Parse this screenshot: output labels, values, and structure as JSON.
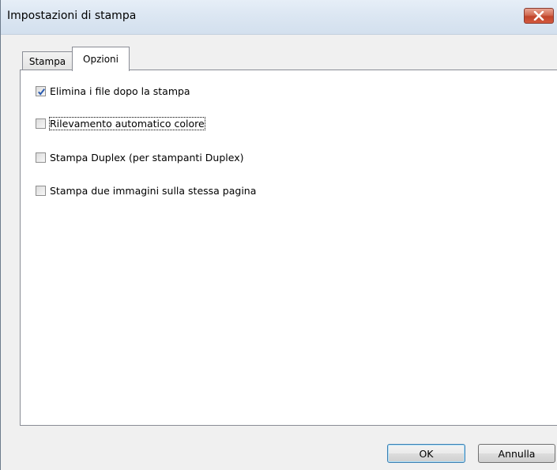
{
  "window": {
    "title": "Impostazioni di stampa"
  },
  "tabs": [
    {
      "label": "Stampa",
      "active": false
    },
    {
      "label": "Opzioni",
      "active": true
    }
  ],
  "options": [
    {
      "label": "Elimina i file dopo la stampa",
      "checked": true
    },
    {
      "label": "Rilevamento automatico colore",
      "checked": false,
      "focused": true
    },
    {
      "label": "Stampa Duplex (per stampanti Duplex)",
      "checked": false
    },
    {
      "label": "Stampa due immagini sulla stessa pagina",
      "checked": false
    }
  ],
  "buttons": {
    "ok": "OK",
    "cancel": "Annulla"
  },
  "icons": {
    "close": "close-icon",
    "check": "checkmark-icon"
  },
  "colors": {
    "close_button": "#c9533a",
    "check_mark": "#2a5bb0",
    "default_button_border": "#3c7fb1"
  }
}
